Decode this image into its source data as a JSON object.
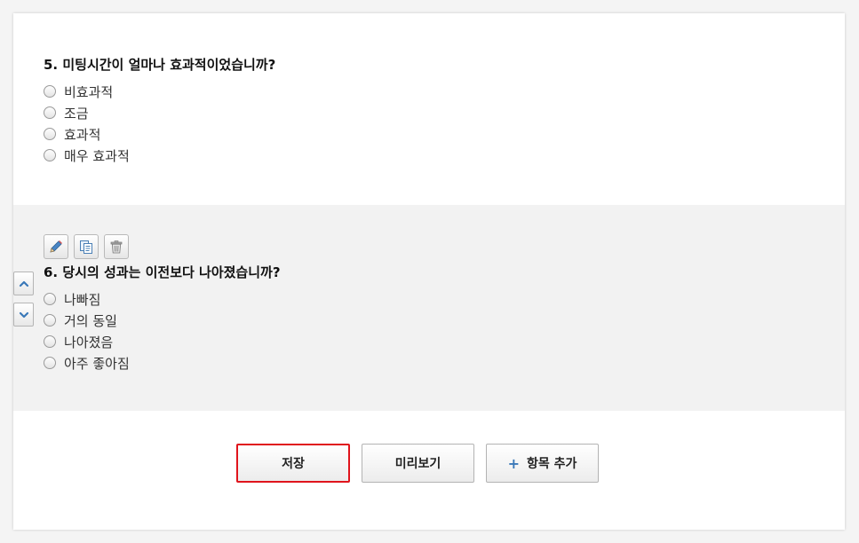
{
  "q5": {
    "title": "5. 미팅시간이 얼마나 효과적이었습니까?",
    "options": [
      "비효과적",
      "조금",
      "효과적",
      "매우 효과적"
    ]
  },
  "q6": {
    "title": "6. 당시의 성과는 이전보다 나아졌습니까?",
    "options": [
      "나빠짐",
      "거의 동일",
      "나아졌음",
      "아주 좋아짐"
    ]
  },
  "tools": [
    "pencil-icon",
    "copy-icon",
    "trash-icon"
  ],
  "buttons": {
    "save": "저장",
    "preview": "미리보기",
    "add_plus": "+",
    "add": "항목 추가"
  },
  "colors": {
    "highlight_border": "#e0141c",
    "active_bg": "#f2f2f2",
    "accent_blue": "#3a78b8"
  }
}
